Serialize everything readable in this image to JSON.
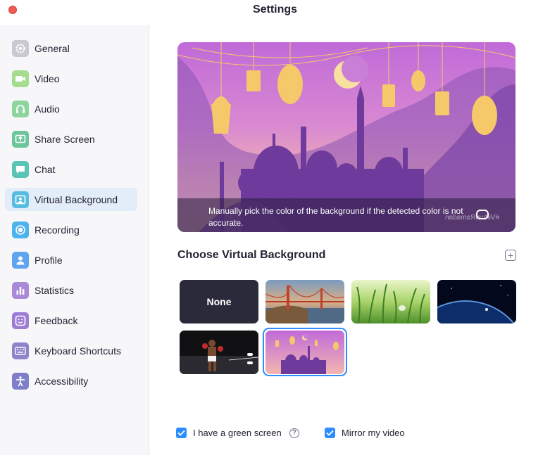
{
  "window": {
    "title": "Settings"
  },
  "sidebar": {
    "items": [
      {
        "label": "General",
        "icon": "gear-icon",
        "color": "#c9c9d1",
        "active": false
      },
      {
        "label": "Video",
        "icon": "video-camera-icon",
        "color": "#a6dc8f",
        "active": false
      },
      {
        "label": "Audio",
        "icon": "headphones-icon",
        "color": "#8dd49d",
        "active": false
      },
      {
        "label": "Share Screen",
        "icon": "share-screen-icon",
        "color": "#6cc59b",
        "active": false
      },
      {
        "label": "Chat",
        "icon": "chat-bubble-icon",
        "color": "#5cc4b4",
        "active": false
      },
      {
        "label": "Virtual Background",
        "icon": "virtual-background-icon",
        "color": "#56bde0",
        "active": true
      },
      {
        "label": "Recording",
        "icon": "recording-icon",
        "color": "#4db3ee",
        "active": false
      },
      {
        "label": "Profile",
        "icon": "person-icon",
        "color": "#5ea4ee",
        "active": false
      },
      {
        "label": "Statistics",
        "icon": "bar-chart-icon",
        "color": "#a98ad9",
        "active": false
      },
      {
        "label": "Feedback",
        "icon": "smiley-icon",
        "color": "#9c7cd4",
        "active": false
      },
      {
        "label": "Keyboard Shortcuts",
        "icon": "keyboard-icon",
        "color": "#8f83cc",
        "active": false
      },
      {
        "label": "Accessibility",
        "icon": "accessibility-icon",
        "color": "#7f7fc9",
        "active": false
      }
    ]
  },
  "preview": {
    "message": "Manually pick the color of the background if the detected color is not accurate.",
    "watermark": "#VirtualRamadan"
  },
  "backgrounds": {
    "title": "Choose Virtual Background",
    "none_label": "None",
    "items": [
      {
        "label": "None",
        "kind": "none"
      },
      {
        "label": "golden-gate-bridge",
        "kind": "image"
      },
      {
        "label": "grass",
        "kind": "image"
      },
      {
        "label": "earth-from-space",
        "kind": "image"
      },
      {
        "label": "boxer",
        "kind": "image"
      },
      {
        "label": "ramadan",
        "kind": "image",
        "selected": true
      }
    ]
  },
  "options": {
    "green_screen": {
      "label": "I have a green screen",
      "checked": true
    },
    "mirror": {
      "label": "Mirror my video",
      "checked": true
    },
    "help": "?"
  },
  "colors": {
    "accent": "#2d8cff",
    "active_nav": "#e3ecf9"
  }
}
